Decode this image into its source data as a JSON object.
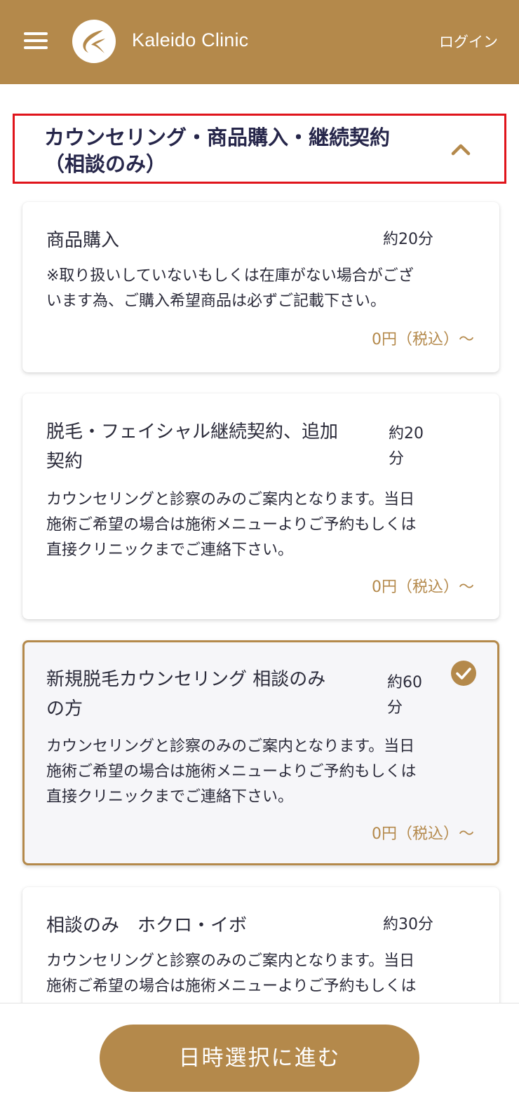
{
  "header": {
    "brand": "Kaleido Clinic",
    "login_label": "ログイン",
    "menu_icon": "hamburger-menu-icon",
    "logo_icon": "kaleido-logo-icon",
    "background_color": "#b4894b"
  },
  "section": {
    "title_line1": "カウンセリング・商品購入・継続契約",
    "title_line2": "（相談のみ）",
    "toggle_icon": "chevron-up-icon",
    "expanded": true
  },
  "cards": [
    {
      "title": "商品購入",
      "duration": "約20分",
      "description_line1": "※取り扱いしていないもしくは在庫がない場合がござ",
      "description_line2": "います為、ご購入希望商品は必ずご記載下さい。",
      "price": "0円（税込）〜",
      "selected": false
    },
    {
      "title_line1": "脱毛・フェイシャル継続契約、追加",
      "title_line2": "契約",
      "duration_line1": "約20",
      "duration_line2": "分",
      "description_line1": "カウンセリングと診察のみのご案内となります。当日",
      "description_line2": "施術ご希望の場合は施術メニューよりご予約もしくは",
      "description_line3": "直接クリニックまでご連絡下さい。",
      "price": "0円（税込）〜",
      "selected": false
    },
    {
      "title_line1": "新規脱毛カウンセリング 相談のみ",
      "title_line2": "の方",
      "duration_line1": "約60",
      "duration_line2": "分",
      "description_line1": "カウンセリングと診察のみのご案内となります。当日",
      "description_line2": "施術ご希望の場合は施術メニューよりご予約もしくは",
      "description_line3": "直接クリニックまでご連絡下さい。",
      "price": "0円（税込）〜",
      "selected": true,
      "selected_icon": "check-circle-icon"
    },
    {
      "title": "相談のみ　ホクロ・イボ",
      "duration": "約30分",
      "description_line1": "カウンセリングと診察のみのご案内となります。当日",
      "description_line2": "施術ご希望の場合は施術メニューよりご予約もしくは",
      "selected": false
    }
  ],
  "footer": {
    "cta_label": "日時選択に進む"
  },
  "colors": {
    "accent": "#b4894b",
    "highlight_border": "#e0141b",
    "title_text": "#26264a"
  }
}
